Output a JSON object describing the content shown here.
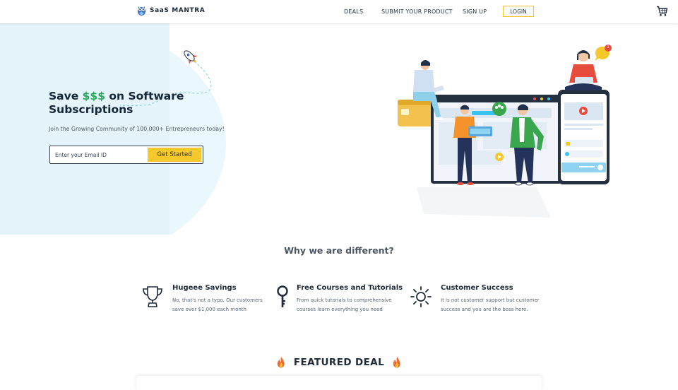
{
  "brand": {
    "name": "SaaS MANTRA",
    "logo_icon": "owl-mascot-icon"
  },
  "nav": {
    "items": [
      {
        "label": "DEALS"
      },
      {
        "label": "SUBMIT YOUR PRODUCT"
      },
      {
        "label": "SIGN UP"
      }
    ],
    "login_label": "LOGIN",
    "cart_icon": "shopping-cart-icon"
  },
  "hero": {
    "headline_prefix": "Save ",
    "headline_highlight": "$$$",
    "headline_suffix": " on Software Subscriptions",
    "subline": "Join the Growing Community of 100,000+ Entrepreneurs today!",
    "email_placeholder": "Enter your Email ID",
    "cta_label": "Get Started",
    "highlight_color": "#27a85a",
    "accent_color": "#f5c82c",
    "notification_count": "1"
  },
  "why": {
    "title": "Why we are different?",
    "features": [
      {
        "icon": "trophy-icon",
        "title": "Hugeee Savings",
        "desc": "No, that's not a typo. Our customers save over $1,000 each month"
      },
      {
        "icon": "key-icon",
        "title": "Free Courses and Tutorials",
        "desc": "From quick tutorials to comprehensive courses learn everything you need"
      },
      {
        "icon": "sun-icon",
        "title": "Customer Success",
        "desc": "It is not customer support but customer success and you are the boss here."
      }
    ]
  },
  "featured": {
    "title": "FEATURED DEAL",
    "icon": "fire-icon"
  }
}
